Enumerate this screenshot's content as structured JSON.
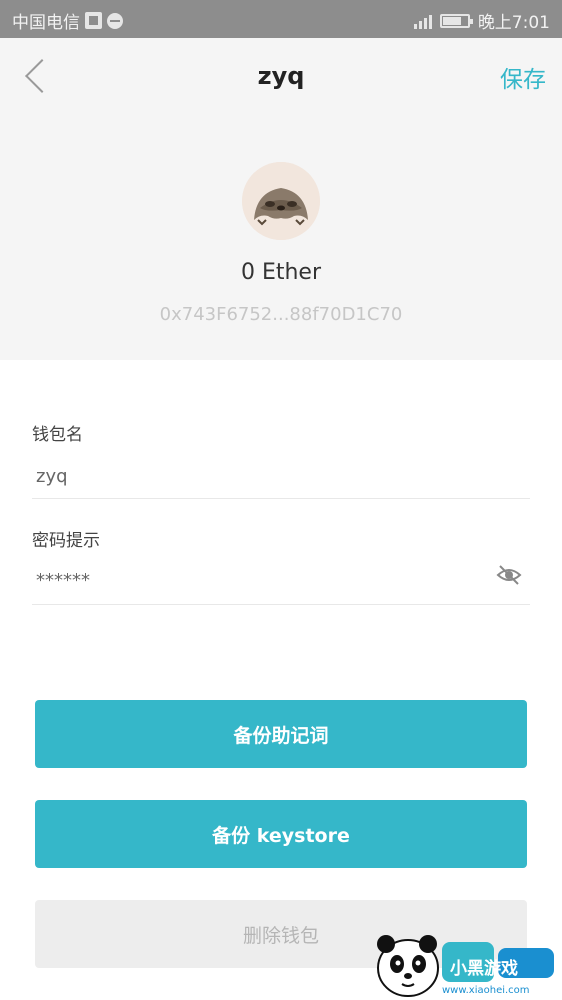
{
  "status_bar": {
    "carrier": "中国电信",
    "time": "晚上7:01",
    "icons": [
      "sim-icon",
      "message-icon",
      "signal-icon",
      "battery-icon"
    ]
  },
  "nav": {
    "title": "zyq",
    "save_label": "保存",
    "back_icon": "chevron-left-icon"
  },
  "wallet": {
    "balance": "0 Ether",
    "address": "0x743F6752...88f70D1C70",
    "avatar_icon": "sloth-avatar"
  },
  "form": {
    "name_label": "钱包名",
    "name_value": "zyq",
    "hint_label": "密码提示",
    "hint_value": "******",
    "visibility_icon": "eye-off-icon"
  },
  "actions": {
    "backup_mnemonic": "备份助记词",
    "backup_keystore": "备份 keystore",
    "delete_wallet": "删除钱包"
  },
  "watermark": {
    "brand": "小黑游戏",
    "url": "www.xiaohei.com"
  },
  "colors": {
    "accent": "#35b7c9",
    "header_bg": "#f5f5f5",
    "status_bar_bg": "#8d8d8d",
    "disabled_bg": "#ededed"
  }
}
